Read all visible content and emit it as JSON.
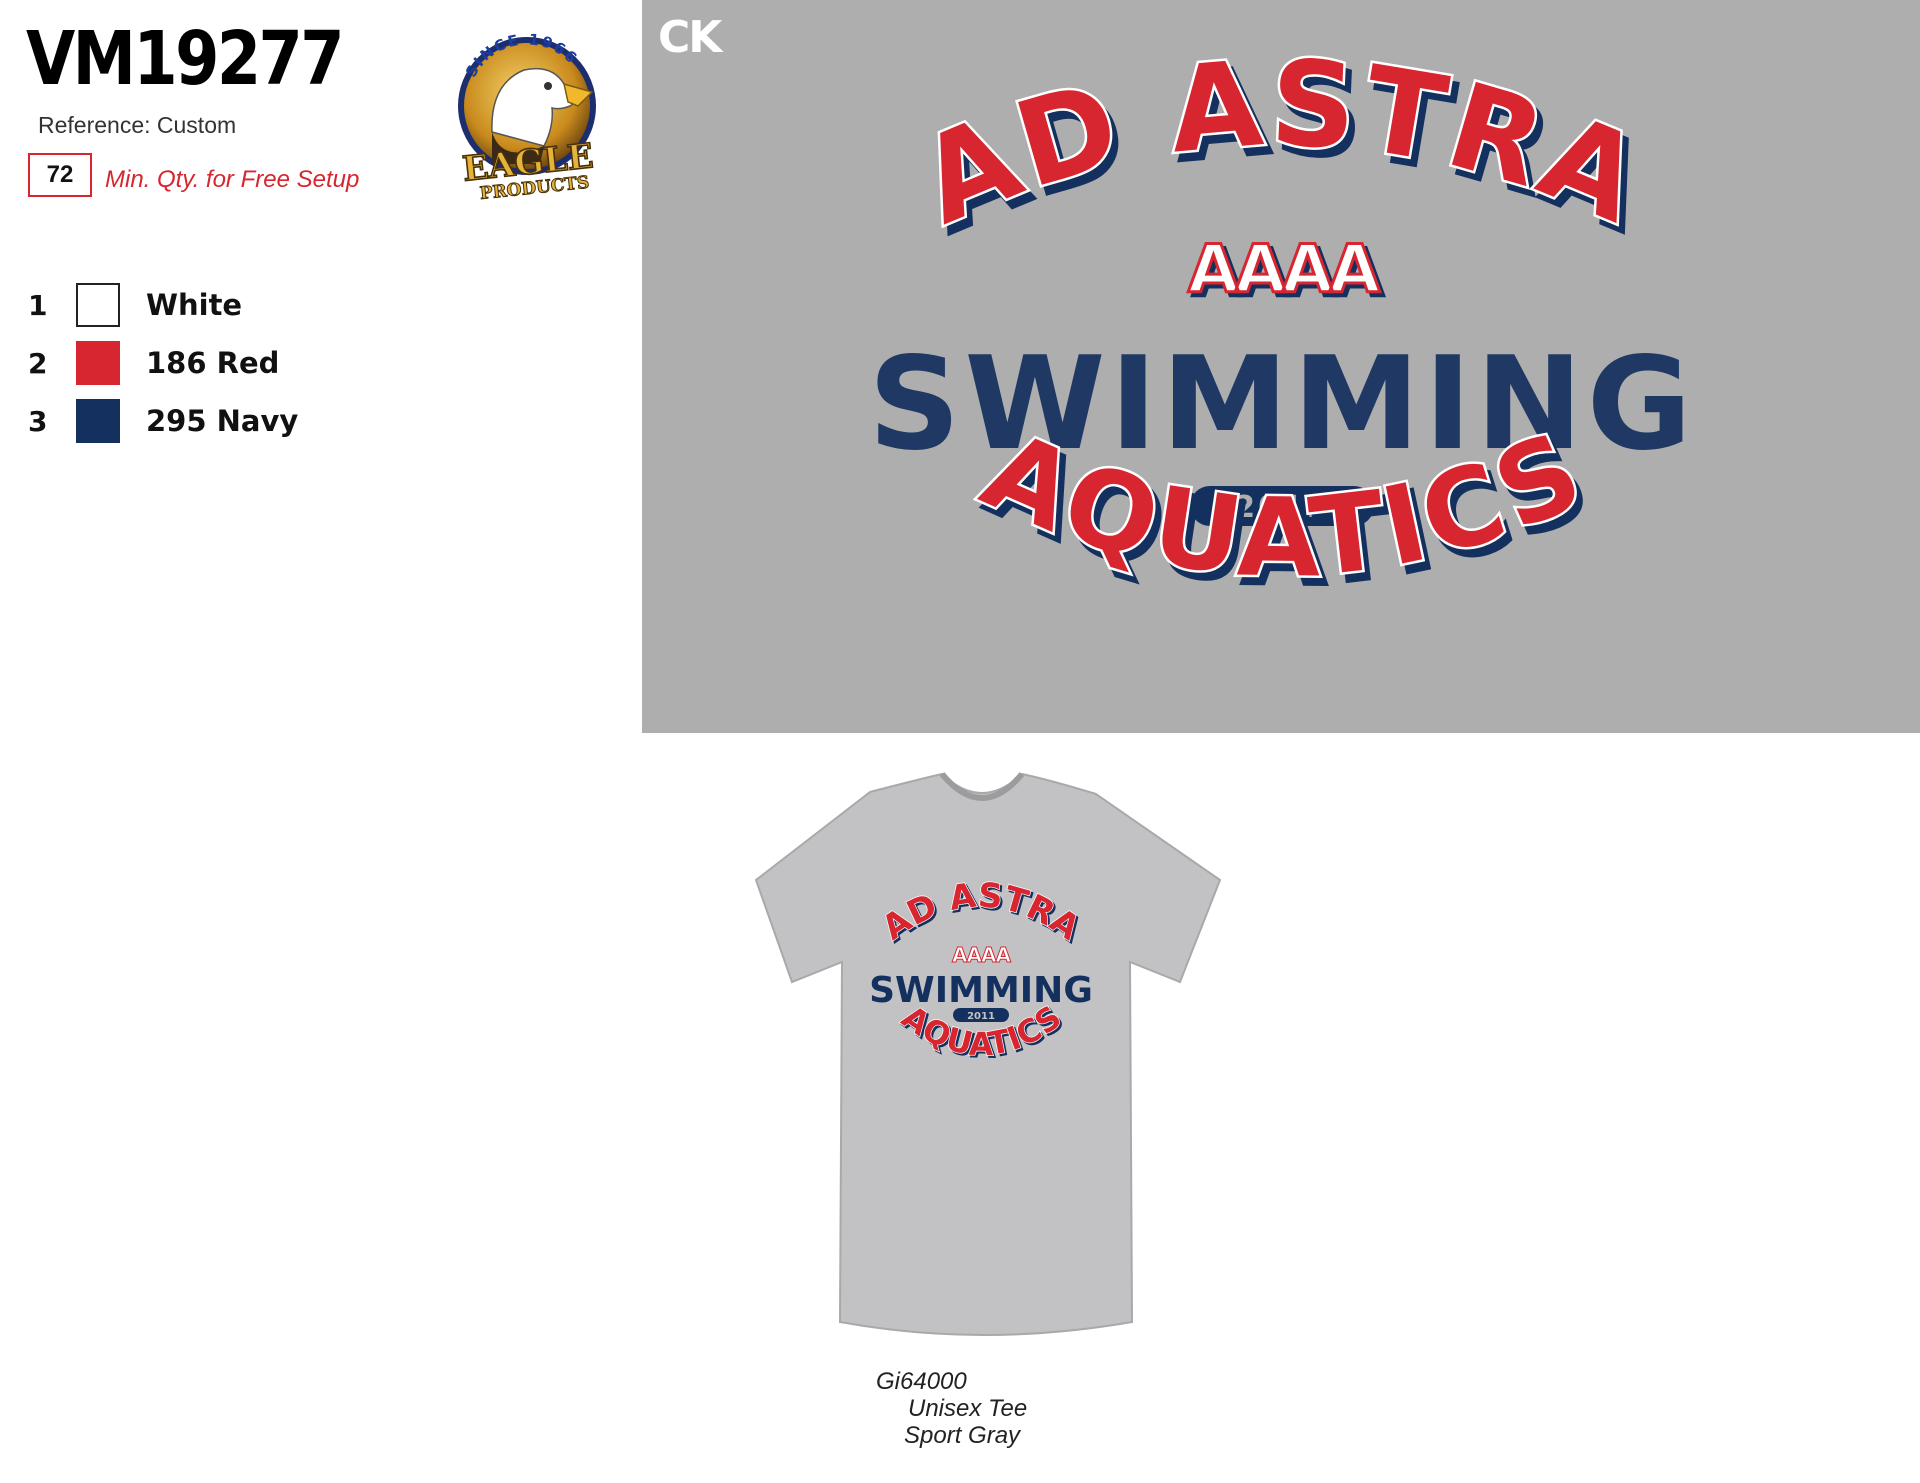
{
  "header": {
    "sku": "VM19277",
    "reference": "Reference: Custom",
    "min_qty": "72",
    "min_qty_label": "Min. Qty. for Free Setup"
  },
  "logo": {
    "arc_text": "SINCE 1966",
    "brand": "EAGLE",
    "sub": "PRODUCTS"
  },
  "colors": [
    {
      "num": "1",
      "name": "White",
      "hex": "#ffffff"
    },
    {
      "num": "2",
      "name": "186 Red",
      "hex": "#d7262f"
    },
    {
      "num": "3",
      "name": "295 Navy",
      "hex": "#14305e"
    }
  ],
  "artwork": {
    "tag": "CK",
    "line1": "AD ASTRA",
    "mark": "AAAA",
    "line2": "SWIMMING",
    "year": "2011",
    "line3": "AQUATICS",
    "background": "#aeaeae"
  },
  "garment": {
    "style": "Gi64000",
    "name": "Unisex Tee",
    "color": "Sport Gray",
    "fabric_hex": "#c2c2c4"
  }
}
